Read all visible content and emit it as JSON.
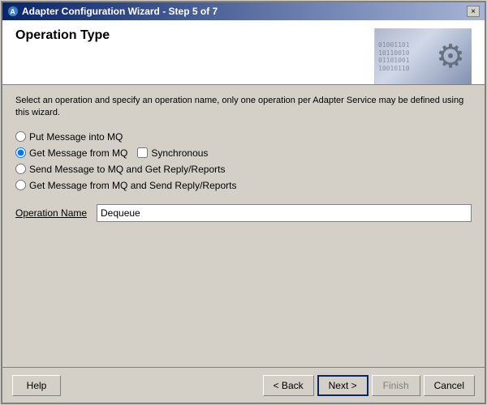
{
  "window": {
    "title": "Adapter Configuration Wizard - Step 5 of 7",
    "close_label": "×"
  },
  "header": {
    "title": "Operation Type",
    "subtitle": "Select an operation and specify an operation name, only one operation per Adapter Service may be defined using this wizard."
  },
  "operations": {
    "options": [
      {
        "id": "opt1",
        "label": "Put Message into MQ",
        "checked": false
      },
      {
        "id": "opt2",
        "label": "Get Message from MQ",
        "checked": true
      },
      {
        "id": "opt3",
        "label": "Send Message to MQ and Get Reply/Reports",
        "checked": false
      },
      {
        "id": "opt4",
        "label": "Get Message from MQ and Send Reply/Reports",
        "checked": false
      }
    ],
    "synchronous_label": "Synchronous",
    "synchronous_checked": false,
    "operation_name_label": "Operation Name",
    "operation_name_value": "Dequeue"
  },
  "footer": {
    "help_label": "Help",
    "back_label": "< Back",
    "next_label": "Next >",
    "finish_label": "Finish",
    "cancel_label": "Cancel"
  }
}
